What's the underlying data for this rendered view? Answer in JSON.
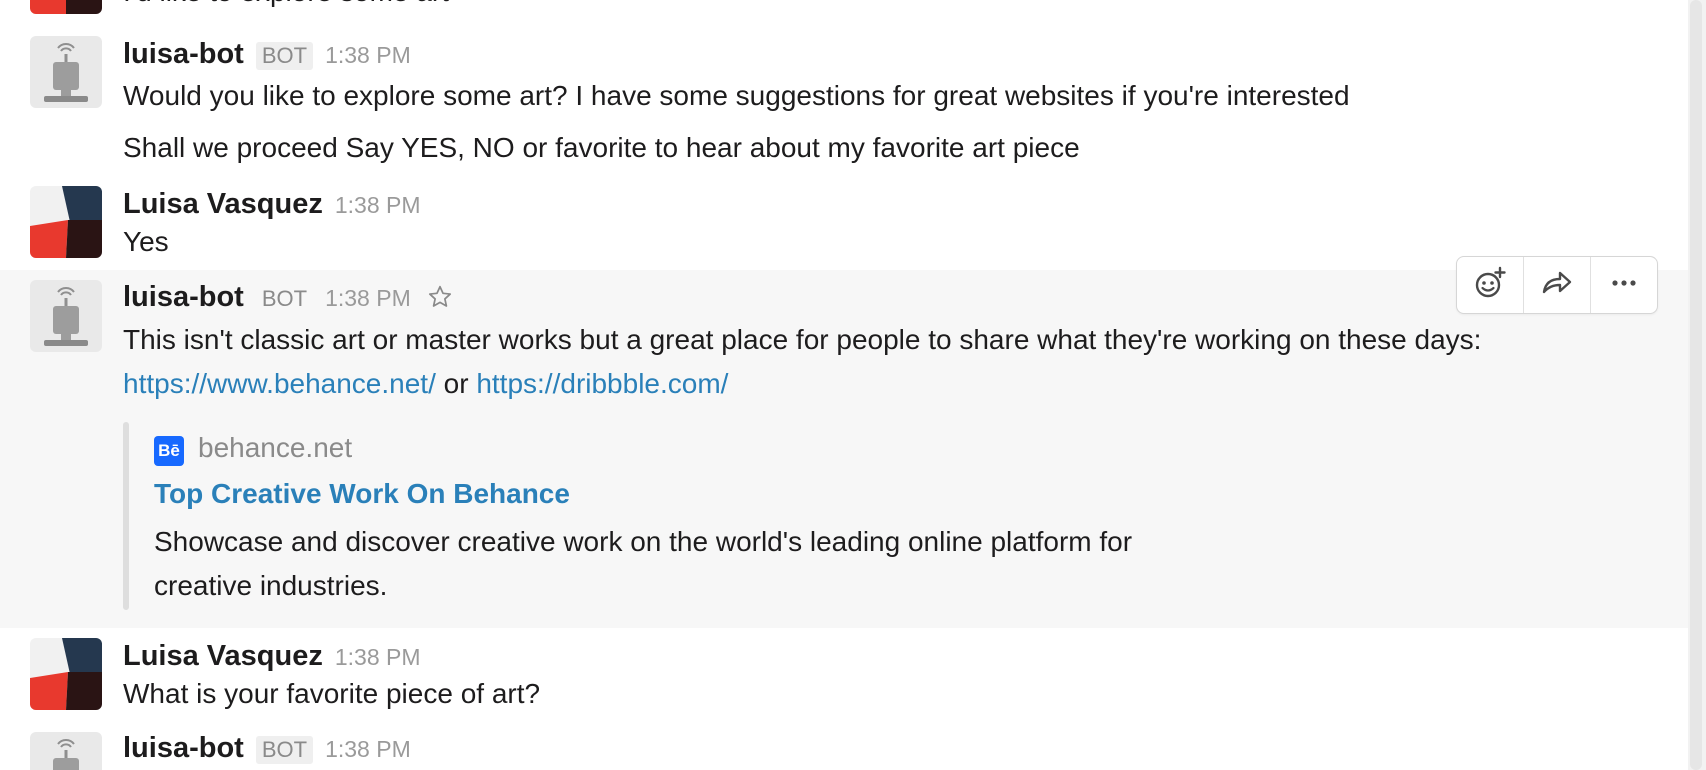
{
  "messages": {
    "m0": {
      "text": "I'd like to explore some art"
    },
    "m1": {
      "sender": "luisa-bot",
      "badge": "BOT",
      "time": "1:38 PM",
      "lines": [
        "Would you like to explore some art? I have some suggestions for great websites if you're interested",
        "Shall we proceed Say YES, NO or favorite to hear about my favorite art piece"
      ]
    },
    "m2": {
      "sender": "Luisa Vasquez",
      "time": "1:38 PM",
      "text": "Yes"
    },
    "m3": {
      "sender": "luisa-bot",
      "badge": "BOT",
      "time": "1:38 PM",
      "text": "This isn't classic art or master works but a great place for people to share what they're working on these days:",
      "link1": "https://www.behance.net/",
      "or": "or",
      "link2": "https://dribbble.com/",
      "attachment": {
        "logo": "Bē",
        "site": "behance.net",
        "title": "Top Creative Work On Behance",
        "desc_line1": "Showcase and discover creative work on the world's leading online platform for",
        "desc_line2": "creative industries."
      }
    },
    "m4": {
      "sender": "Luisa Vasquez",
      "time": "1:38 PM",
      "text": "What is your favorite piece of art?"
    },
    "m5": {
      "sender": "luisa-bot",
      "badge": "BOT",
      "time": "1:38 PM"
    }
  },
  "hover_actions": [
    {
      "icon": "add-reaction-icon"
    },
    {
      "icon": "share-icon"
    },
    {
      "icon": "more-actions-icon"
    }
  ],
  "colors": {
    "link": "#2a80b9",
    "hover_bg": "#f7f7f7",
    "avatar_red": "#e8392e",
    "avatar_navy": "#25384f",
    "avatar_dark": "#2a1414",
    "behance_blue": "#1769ff"
  }
}
